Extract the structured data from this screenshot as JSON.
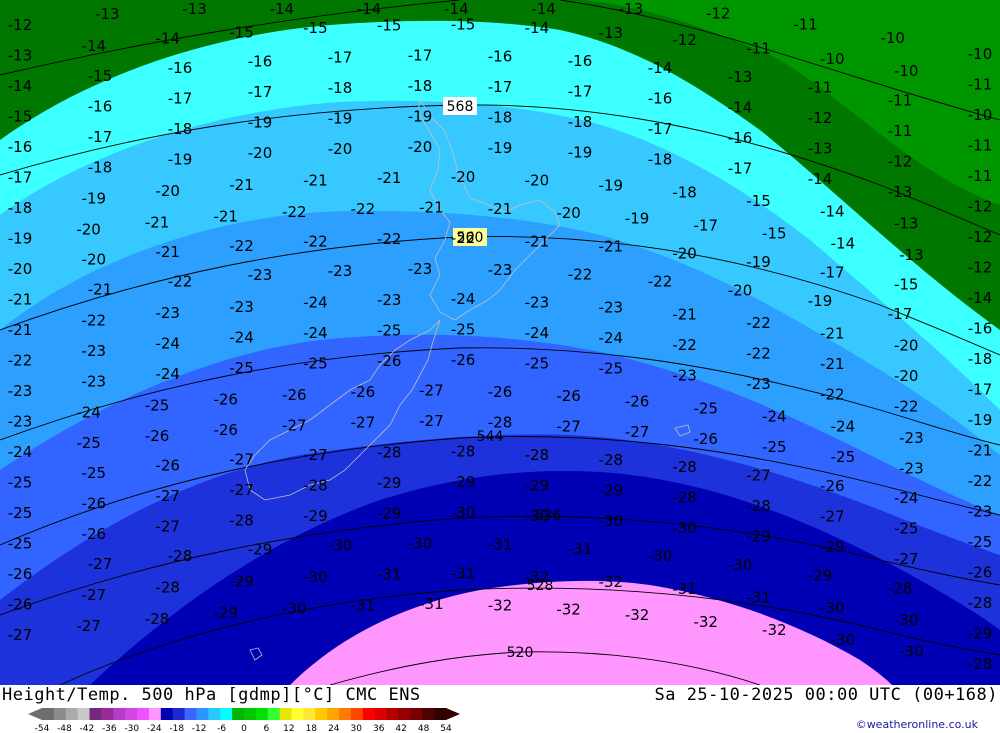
{
  "header": {
    "title_left": "Height/Temp. 500 hPa [gdmp][°C] CMC ENS",
    "title_right": "Sa 25-10-2025 00:00 UTC (00+168)"
  },
  "credit": "©weatheronline.co.uk",
  "legend": {
    "tick_labels": [
      "-54",
      "-48",
      "-42",
      "-36",
      "-30",
      "-24",
      "-18",
      "-12",
      "-6",
      "0",
      "6",
      "12",
      "18",
      "24",
      "30",
      "36",
      "42",
      "48",
      "54"
    ],
    "colors": [
      "#6e6e6e",
      "#8c8c8c",
      "#aaaaaa",
      "#c8c8c8",
      "#78287a",
      "#9a2a9a",
      "#b43cc8",
      "#d246e6",
      "#f050ff",
      "#ff96ff",
      "#0000b4",
      "#1e28d2",
      "#3c64ff",
      "#2a96ff",
      "#28c8ff",
      "#00ffff",
      "#00b400",
      "#00c800",
      "#00e100",
      "#32ff32",
      "#e6e600",
      "#ffff32",
      "#ffe632",
      "#ffc800",
      "#ffa500",
      "#ff7800",
      "#ff4600",
      "#ff0000",
      "#dc0000",
      "#b40000",
      "#960000",
      "#780000",
      "#500000",
      "#320000"
    ]
  },
  "band_colors": {
    "dark_green": "#007800",
    "green": "#009600",
    "cyan": "#3cffff",
    "light_blue": "#37c8ff",
    "mid_blue": "#2da0ff",
    "blue": "#3264ff",
    "royal_blue": "#1e32dc",
    "navy": "#0000b4",
    "pink": "#ff96ff"
  },
  "height_labels": [
    {
      "text": "568"
    },
    {
      "text": "560"
    },
    {
      "text": "544"
    },
    {
      "text": "536"
    },
    {
      "text": "528"
    },
    {
      "text": "520"
    }
  ],
  "temp_labels": [
    {
      "v": "-12"
    },
    {
      "v": "-13"
    },
    {
      "v": "-13"
    },
    {
      "v": "-14"
    },
    {
      "v": "-14"
    },
    {
      "v": "-14"
    },
    {
      "v": "-14"
    },
    {
      "v": "-13"
    },
    {
      "v": "-12"
    },
    {
      "v": "-11"
    },
    {
      "v": "-10"
    },
    {
      "v": "-10"
    },
    {
      "v": "-13"
    },
    {
      "v": "-14"
    },
    {
      "v": "-14"
    },
    {
      "v": "-15"
    },
    {
      "v": "-15"
    },
    {
      "v": "-15"
    },
    {
      "v": "-15"
    },
    {
      "v": "-14"
    },
    {
      "v": "-13"
    },
    {
      "v": "-12"
    },
    {
      "v": "-11"
    },
    {
      "v": "-10"
    },
    {
      "v": "-10"
    },
    {
      "v": "-11"
    },
    {
      "v": "-14"
    },
    {
      "v": "-15"
    },
    {
      "v": "-16"
    },
    {
      "v": "-16"
    },
    {
      "v": "-17"
    },
    {
      "v": "-17"
    },
    {
      "v": "-16"
    },
    {
      "v": "-16"
    },
    {
      "v": "-14"
    },
    {
      "v": "-13"
    },
    {
      "v": "-11"
    },
    {
      "v": "-11"
    },
    {
      "v": "-10"
    },
    {
      "v": "-15"
    },
    {
      "v": "-16"
    },
    {
      "v": "-17"
    },
    {
      "v": "-17"
    },
    {
      "v": "-18"
    },
    {
      "v": "-18"
    },
    {
      "v": "-17"
    },
    {
      "v": "-17"
    },
    {
      "v": "-16"
    },
    {
      "v": "-14"
    },
    {
      "v": "-12"
    },
    {
      "v": "-11"
    },
    {
      "v": "-11"
    },
    {
      "v": "-16"
    },
    {
      "v": "-17"
    },
    {
      "v": "-18"
    },
    {
      "v": "-19"
    },
    {
      "v": "-19"
    },
    {
      "v": "-19"
    },
    {
      "v": "-18"
    },
    {
      "v": "-18"
    },
    {
      "v": "-17"
    },
    {
      "v": "-16"
    },
    {
      "v": "-13"
    },
    {
      "v": "-12"
    },
    {
      "v": "-11"
    },
    {
      "v": "-17"
    },
    {
      "v": "-18"
    },
    {
      "v": "-19"
    },
    {
      "v": "-20"
    },
    {
      "v": "-20"
    },
    {
      "v": "-20"
    },
    {
      "v": "-19"
    },
    {
      "v": "-19"
    },
    {
      "v": "-18"
    },
    {
      "v": "-17"
    },
    {
      "v": "-14"
    },
    {
      "v": "-13"
    },
    {
      "v": "-12"
    },
    {
      "v": "-18"
    },
    {
      "v": "-19"
    },
    {
      "v": "-20"
    },
    {
      "v": "-21"
    },
    {
      "v": "-21"
    },
    {
      "v": "-21"
    },
    {
      "v": "-20"
    },
    {
      "v": "-20"
    },
    {
      "v": "-19"
    },
    {
      "v": "-18"
    },
    {
      "v": "-15"
    },
    {
      "v": "-14"
    },
    {
      "v": "-13"
    },
    {
      "v": "-12"
    },
    {
      "v": "-19"
    },
    {
      "v": "-20"
    },
    {
      "v": "-21"
    },
    {
      "v": "-21"
    },
    {
      "v": "-22"
    },
    {
      "v": "-22"
    },
    {
      "v": "-21"
    },
    {
      "v": "-21"
    },
    {
      "v": "-20"
    },
    {
      "v": "-19"
    },
    {
      "v": "-17"
    },
    {
      "v": "-15"
    },
    {
      "v": "-14"
    },
    {
      "v": "-13"
    },
    {
      "v": "-12"
    },
    {
      "v": "-20"
    },
    {
      "v": "-20"
    },
    {
      "v": "-21"
    },
    {
      "v": "-22"
    },
    {
      "v": "-22"
    },
    {
      "v": "-22"
    },
    {
      "v": "-22"
    },
    {
      "v": "-21"
    },
    {
      "v": "-21"
    },
    {
      "v": "-20"
    },
    {
      "v": "-19"
    },
    {
      "v": "-17"
    },
    {
      "v": "-15"
    },
    {
      "v": "-14"
    },
    {
      "v": "-21"
    },
    {
      "v": "-21"
    },
    {
      "v": "-22"
    },
    {
      "v": "-23"
    },
    {
      "v": "-23"
    },
    {
      "v": "-23"
    },
    {
      "v": "-23"
    },
    {
      "v": "-22"
    },
    {
      "v": "-22"
    },
    {
      "v": "-20"
    },
    {
      "v": "-19"
    },
    {
      "v": "-17"
    },
    {
      "v": "-16"
    },
    {
      "v": "-21"
    },
    {
      "v": "-22"
    },
    {
      "v": "-23"
    },
    {
      "v": "-23"
    },
    {
      "v": "-24"
    },
    {
      "v": "-23"
    },
    {
      "v": "-24"
    },
    {
      "v": "-23"
    },
    {
      "v": "-23"
    },
    {
      "v": "-21"
    },
    {
      "v": "-22"
    },
    {
      "v": "-21"
    },
    {
      "v": "-20"
    },
    {
      "v": "-18"
    },
    {
      "v": "-22"
    },
    {
      "v": "-23"
    },
    {
      "v": "-24"
    },
    {
      "v": "-24"
    },
    {
      "v": "-24"
    },
    {
      "v": "-25"
    },
    {
      "v": "-25"
    },
    {
      "v": "-24"
    },
    {
      "v": "-24"
    },
    {
      "v": "-22"
    },
    {
      "v": "-22"
    },
    {
      "v": "-21"
    },
    {
      "v": "-20"
    },
    {
      "v": "-17"
    },
    {
      "v": "-23"
    },
    {
      "v": "-23"
    },
    {
      "v": "-24"
    },
    {
      "v": "-25"
    },
    {
      "v": "-25"
    },
    {
      "v": "-26"
    },
    {
      "v": "-26"
    },
    {
      "v": "-25"
    },
    {
      "v": "-25"
    },
    {
      "v": "-23"
    },
    {
      "v": "-23"
    },
    {
      "v": "-22"
    },
    {
      "v": "-22"
    },
    {
      "v": "-19"
    },
    {
      "v": "-23"
    },
    {
      "v": "-24"
    },
    {
      "v": "-25"
    },
    {
      "v": "-26"
    },
    {
      "v": "-26"
    },
    {
      "v": "-26"
    },
    {
      "v": "-27"
    },
    {
      "v": "-26"
    },
    {
      "v": "-26"
    },
    {
      "v": "-26"
    },
    {
      "v": "-25"
    },
    {
      "v": "-24"
    },
    {
      "v": "-24"
    },
    {
      "v": "-23"
    },
    {
      "v": "-21"
    },
    {
      "v": "-24"
    },
    {
      "v": "-25"
    },
    {
      "v": "-26"
    },
    {
      "v": "-26"
    },
    {
      "v": "-27"
    },
    {
      "v": "-27"
    },
    {
      "v": "-27"
    },
    {
      "v": "-28"
    },
    {
      "v": "-27"
    },
    {
      "v": "-27"
    },
    {
      "v": "-26"
    },
    {
      "v": "-25"
    },
    {
      "v": "-25"
    },
    {
      "v": "-23"
    },
    {
      "v": "-22"
    },
    {
      "v": "-25"
    },
    {
      "v": "-25"
    },
    {
      "v": "-26"
    },
    {
      "v": "-27"
    },
    {
      "v": "-27"
    },
    {
      "v": "-28"
    },
    {
      "v": "-28"
    },
    {
      "v": "-28"
    },
    {
      "v": "-28"
    },
    {
      "v": "-28"
    },
    {
      "v": "-27"
    },
    {
      "v": "-26"
    },
    {
      "v": "-24"
    },
    {
      "v": "-23"
    },
    {
      "v": "-25"
    },
    {
      "v": "-26"
    },
    {
      "v": "-27"
    },
    {
      "v": "-27"
    },
    {
      "v": "-28"
    },
    {
      "v": "-29"
    },
    {
      "v": "-29"
    },
    {
      "v": "-29"
    },
    {
      "v": "-29"
    },
    {
      "v": "-28"
    },
    {
      "v": "-28"
    },
    {
      "v": "-27"
    },
    {
      "v": "-25"
    },
    {
      "v": "-25"
    },
    {
      "v": "-25"
    },
    {
      "v": "-26"
    },
    {
      "v": "-27"
    },
    {
      "v": "-28"
    },
    {
      "v": "-29"
    },
    {
      "v": "-29"
    },
    {
      "v": "-30"
    },
    {
      "v": "-30"
    },
    {
      "v": "-30"
    },
    {
      "v": "-30"
    },
    {
      "v": "-29"
    },
    {
      "v": "-29"
    },
    {
      "v": "-27"
    },
    {
      "v": "-26"
    },
    {
      "v": "-26"
    },
    {
      "v": "-27"
    },
    {
      "v": "-28"
    },
    {
      "v": "-29"
    },
    {
      "v": "-30"
    },
    {
      "v": "-30"
    },
    {
      "v": "-31"
    },
    {
      "v": "-31"
    },
    {
      "v": "-30"
    },
    {
      "v": "-30"
    },
    {
      "v": "-29"
    },
    {
      "v": "-28"
    },
    {
      "v": "-28"
    },
    {
      "v": "-26"
    },
    {
      "v": "-27"
    },
    {
      "v": "-28"
    },
    {
      "v": "-29"
    },
    {
      "v": "-30"
    },
    {
      "v": "-31"
    },
    {
      "v": "-31"
    },
    {
      "v": "-32"
    },
    {
      "v": "-32"
    },
    {
      "v": "-31"
    },
    {
      "v": "-31"
    },
    {
      "v": "-30"
    },
    {
      "v": "-30"
    },
    {
      "v": "-29"
    },
    {
      "v": "-27"
    },
    {
      "v": "-27"
    },
    {
      "v": "-28"
    },
    {
      "v": "-29"
    },
    {
      "v": "-30"
    },
    {
      "v": "-31"
    },
    {
      "v": "-31"
    },
    {
      "v": "-32"
    },
    {
      "v": "-32"
    },
    {
      "v": "-32"
    },
    {
      "v": "-32"
    },
    {
      "v": "-32"
    },
    {
      "v": "-30"
    },
    {
      "v": "-30"
    },
    {
      "v": "-28"
    }
  ]
}
